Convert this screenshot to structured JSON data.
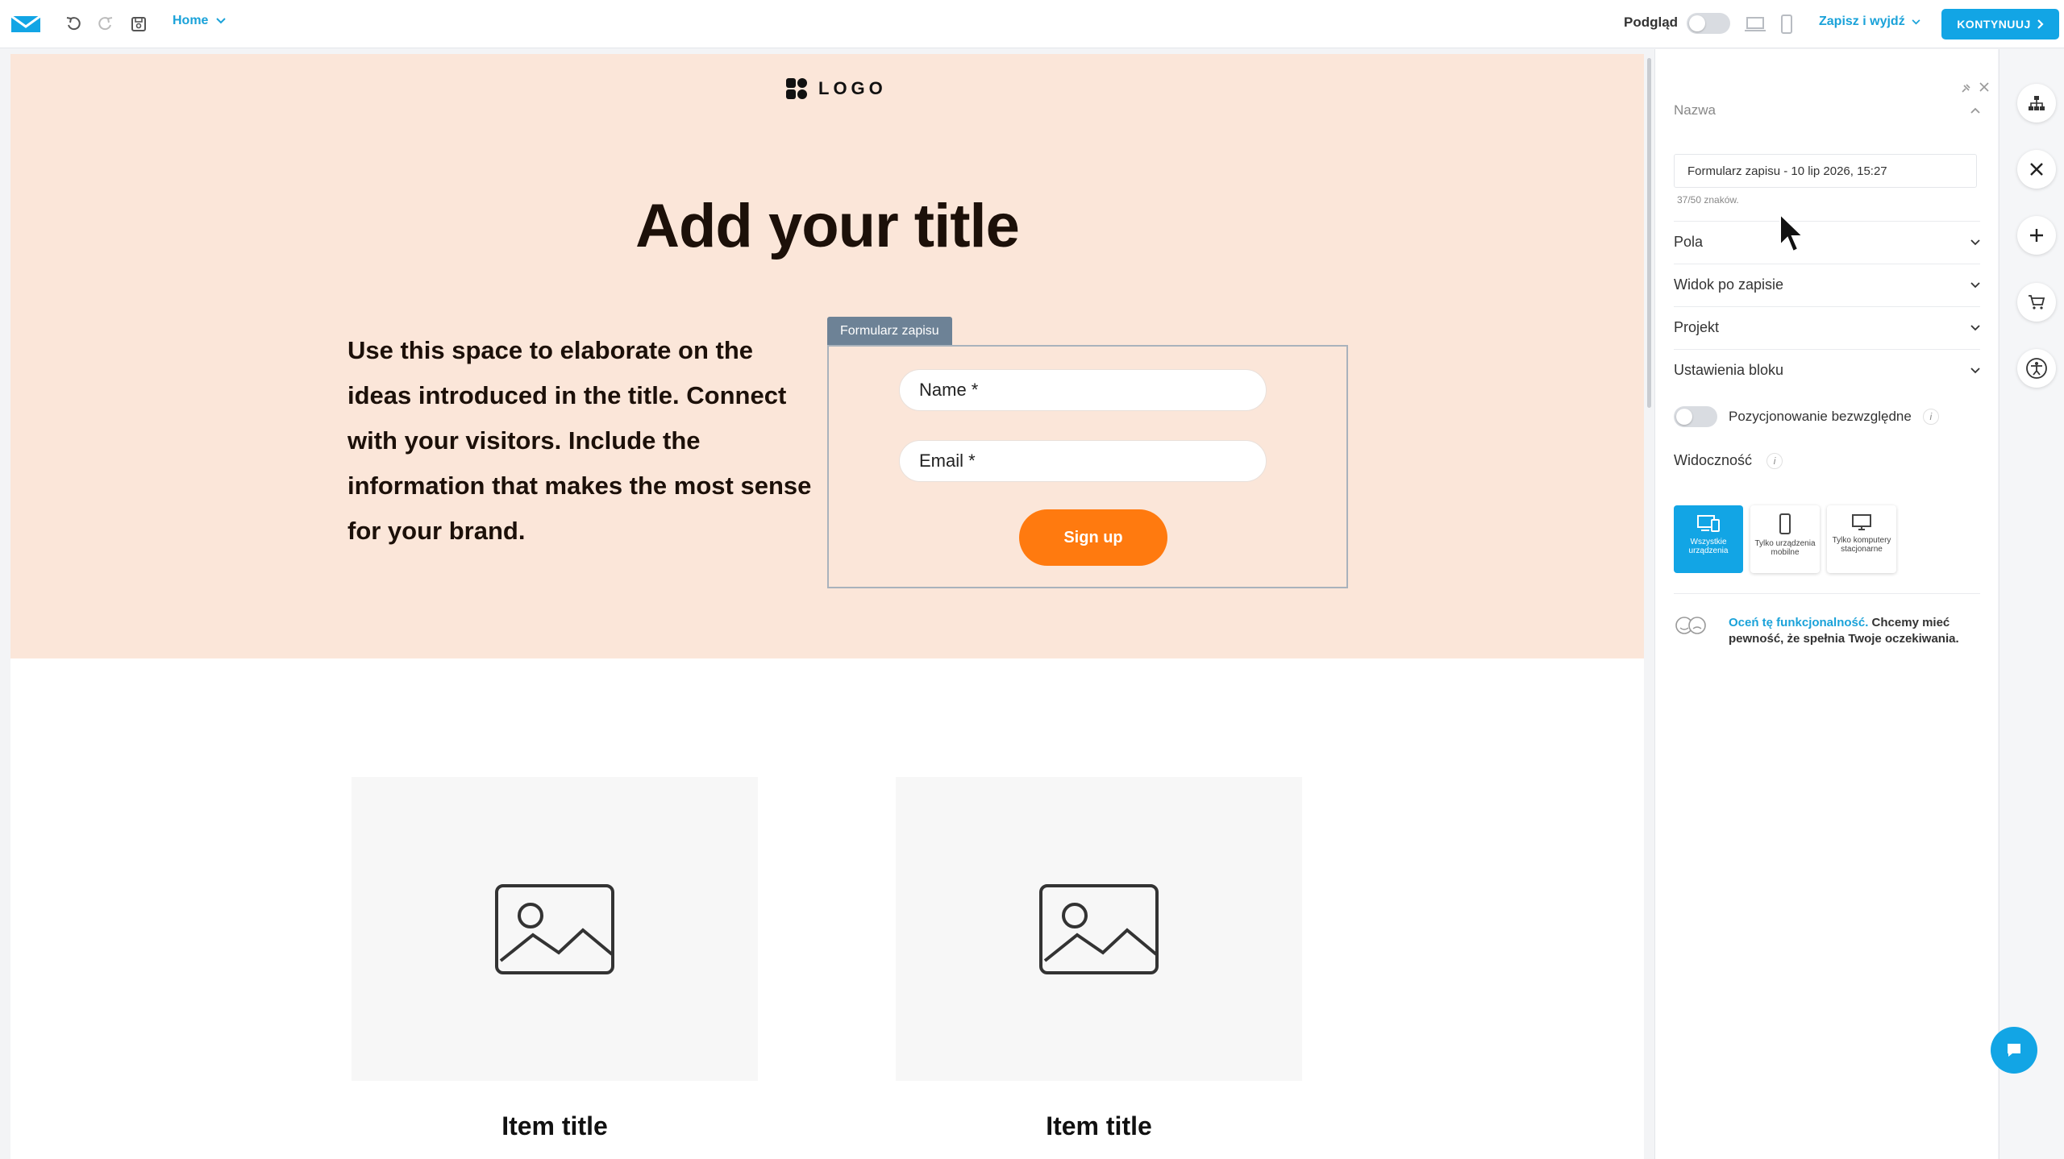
{
  "toolbar": {
    "page_menu": "Home",
    "preview_label": "Podgląd",
    "save_exit": "Zapisz i wyjdź",
    "continue": "KONTYNUUJ",
    "icons": [
      "mail-logo-icon",
      "undo-icon",
      "redo-icon",
      "save-icon",
      "laptop-icon",
      "mobile-icon"
    ]
  },
  "canvas": {
    "logo_text": "LOGO",
    "title": "Add your title",
    "body_text": "Use this space to elaborate on the ideas introduced in the title. Connect with your visitors. Include the information that makes the most sense for your brand.",
    "form": {
      "tag": "Formularz zapisu",
      "name_placeholder": "Name *",
      "email_placeholder": "Email *",
      "submit": "Sign up"
    },
    "items": [
      {
        "title": "Item title"
      },
      {
        "title": "Item title"
      }
    ]
  },
  "panel": {
    "name_section": "Nazwa",
    "name_value": "Formularz zapisu - 10 lip 2026, 15:27",
    "char_count": "37/50 znaków.",
    "sections": [
      "Pola",
      "Widok po zapisie",
      "Projekt",
      "Ustawienia bloku"
    ],
    "absolute_positioning": "Pozycjonowanie bezwzględne",
    "visibility": "Widoczność",
    "visibility_options": [
      "Wszystkie urządzenia",
      "Tylko urządzenia mobilne",
      "Tylko komputery stacjonarne"
    ],
    "visibility_selected": 0,
    "feedback_link": "Oceń tę funkcjonalność.",
    "feedback_text": "Chcemy mieć pewność, że spełnia Twoje oczekiwania.",
    "info_glyph": "i"
  },
  "colors": {
    "accent": "#12a5e5",
    "hero_bg": "#fbe6d9",
    "button_orange": "#ff7a0f"
  }
}
